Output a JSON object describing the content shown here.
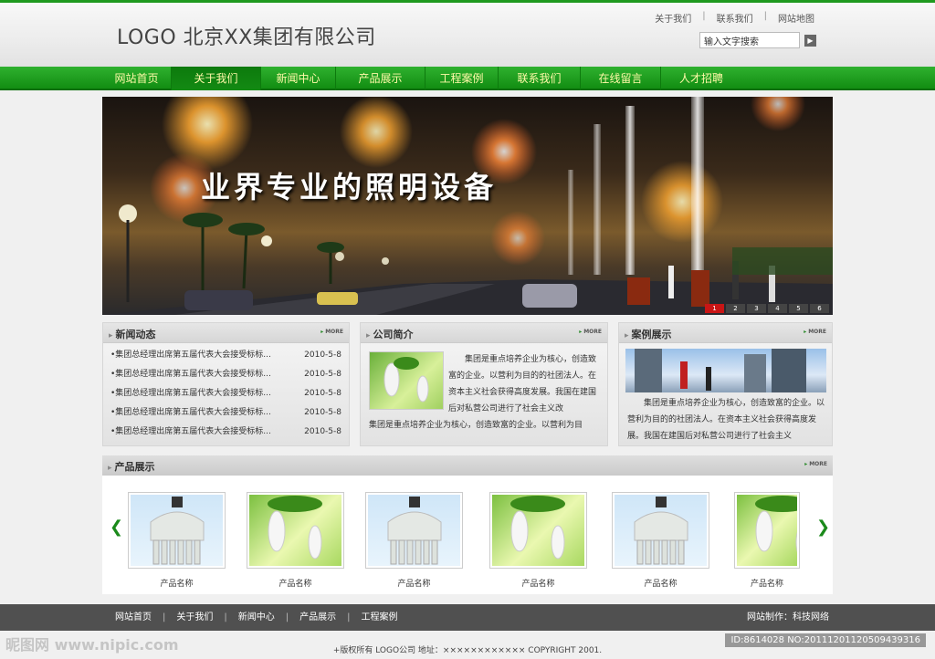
{
  "header": {
    "logo_text": "LOGO  北京XX集团有限公司",
    "top_links": [
      "关于我们",
      "联系我们",
      "网站地图"
    ],
    "search_placeholder": "输入文字搜索",
    "search_icon": "arrow-right-icon"
  },
  "nav": {
    "items": [
      "网站首页",
      "关于我们",
      "新闻中心",
      "产品展示",
      "工程案例",
      "联系我们",
      "在线留言",
      "人才招聘"
    ],
    "active_index": 1,
    "bg_color": "#1a9a1a",
    "text_color": "#fff9a8"
  },
  "banner": {
    "title": "业界专业的照明设备",
    "pages": [
      "1",
      "2",
      "3",
      "4",
      "5",
      "6"
    ],
    "active_page": 0
  },
  "news": {
    "title": "新闻动态",
    "more": "MORE",
    "items": [
      {
        "text": "•集团总经理出席第五届代表大会接受标标...",
        "date": "2010-5-8"
      },
      {
        "text": "•集团总经理出席第五届代表大会接受标标...",
        "date": "2010-5-8"
      },
      {
        "text": "•集团总经理出席第五届代表大会接受标标...",
        "date": "2010-5-8"
      },
      {
        "text": "•集团总经理出席第五届代表大会接受标标...",
        "date": "2010-5-8"
      },
      {
        "text": "•集团总经理出席第五届代表大会接受标标...",
        "date": "2010-5-8"
      }
    ]
  },
  "about": {
    "title": "公司简介",
    "more": "MORE",
    "text_right": "集团是重点培养企业为核心，创造致富的企业。以营利为目的的社团法人。在资本主义社会获得高度发展。我国在建国后对私营公司进行了社会主义改",
    "text_bottom": "集团是重点培养企业为核心，创造致富的企业。以营利为目"
  },
  "cases": {
    "title": "案例展示",
    "more": "MORE",
    "text": "集团是重点培养企业为核心，创造致富的企业。以营利为目的的社团法人。在资本主义社会获得高度发展。我国在建国后对私营公司进行了社会主义"
  },
  "products": {
    "title": "产品展示",
    "more": "MORE",
    "prev_icon": "chevron-left-icon",
    "next_icon": "chevron-right-icon",
    "items": [
      {
        "name": "产品名称",
        "kind": "bulb-white"
      },
      {
        "name": "产品名称",
        "kind": "bulb-green"
      },
      {
        "name": "产品名称",
        "kind": "bulb-white"
      },
      {
        "name": "产品名称",
        "kind": "bulb-green"
      },
      {
        "name": "产品名称",
        "kind": "bulb-white"
      },
      {
        "name": "产品名称",
        "kind": "bulb-green"
      }
    ]
  },
  "footer": {
    "links": [
      "网站首页",
      "关于我们",
      "新闻中心",
      "产品展示",
      "工程案例"
    ],
    "maker": "网站制作：科技网络",
    "copyright": "+版权所有 LOGO公司      地址：×××××××××××× COPYRIGHT 2001."
  },
  "watermark": {
    "left": "昵图网 www.nipic.com",
    "right": "ID:8614028 NO:20111201120509439316"
  }
}
